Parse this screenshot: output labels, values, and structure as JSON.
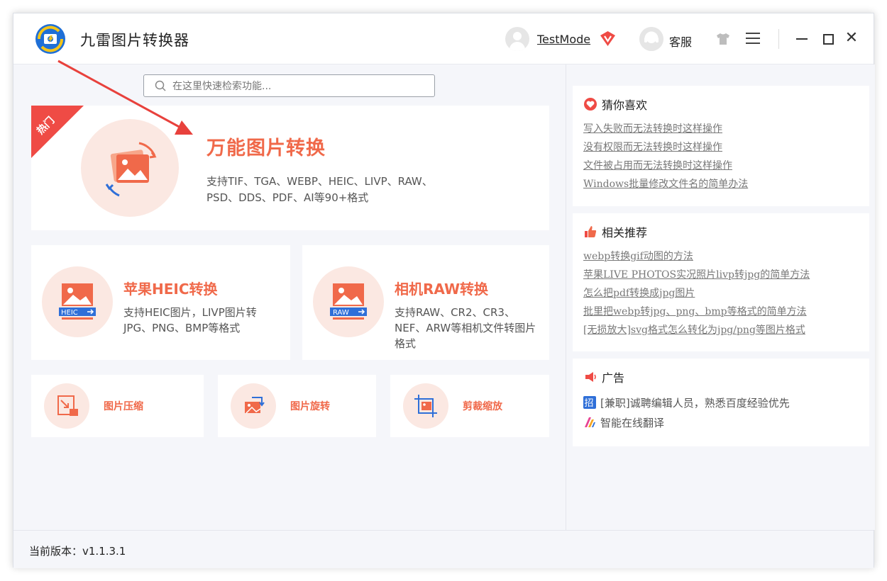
{
  "app": {
    "title": "九雷图片转换器"
  },
  "header": {
    "username": "TestMode",
    "service_label": "客服"
  },
  "search": {
    "placeholder": "在这里快速检索功能..."
  },
  "hero": {
    "badge": "热门",
    "title": "万能图片转换",
    "desc_line1": "支持TIF、TGA、WEBP、HEIC、LIVP、RAW、",
    "desc_line2": "PSD、DDS、PDF、AI等90+格式"
  },
  "features": {
    "heic": {
      "icon_text": "HEIC",
      "title": "苹果HEIC转换",
      "desc": "支持HEIC图片，LIVP图片转JPG、PNG、BMP等格式"
    },
    "raw": {
      "icon_text": "RAW",
      "title": "相机RAW转换",
      "desc": "支持RAW、CR2、CR3、NEF、ARW等相机文件转图片格式"
    }
  },
  "tools": [
    {
      "label": "图片压缩"
    },
    {
      "label": "图片旋转"
    },
    {
      "label": "剪裁缩放"
    }
  ],
  "sidebar": {
    "guess": {
      "title": "猜你喜欢",
      "links": [
        "写入失败而无法转换时这样操作",
        "没有权限而无法转换时这样操作",
        "文件被占用而无法转换时这样操作",
        "Windows批量修改文件名的简单办法"
      ]
    },
    "related": {
      "title": "相关推荐",
      "links": [
        "webp转换gif动图的方法",
        "苹果LIVE PHOTOS实况照片livp转jpg的简单方法",
        "怎么把pdf转换成jpg图片",
        "批里把webp转jpg、png、bmp等格式的简单方法",
        "[无损放大]svg格式怎么转化为jpg/png等图片格式"
      ]
    },
    "ads": {
      "title": "广告",
      "items": [
        "[兼职]诚聘编辑人员，熟悉百度经验优先",
        "智能在线翻译"
      ]
    }
  },
  "status": {
    "version": "当前版本：v1.1.3.1"
  },
  "colors": {
    "accent": "#f0694a",
    "ribbon": "#ef4b45",
    "circle_bg": "#fbe8e2",
    "arrow": "#e8413c",
    "heic_blue": "#2f6fd8"
  }
}
